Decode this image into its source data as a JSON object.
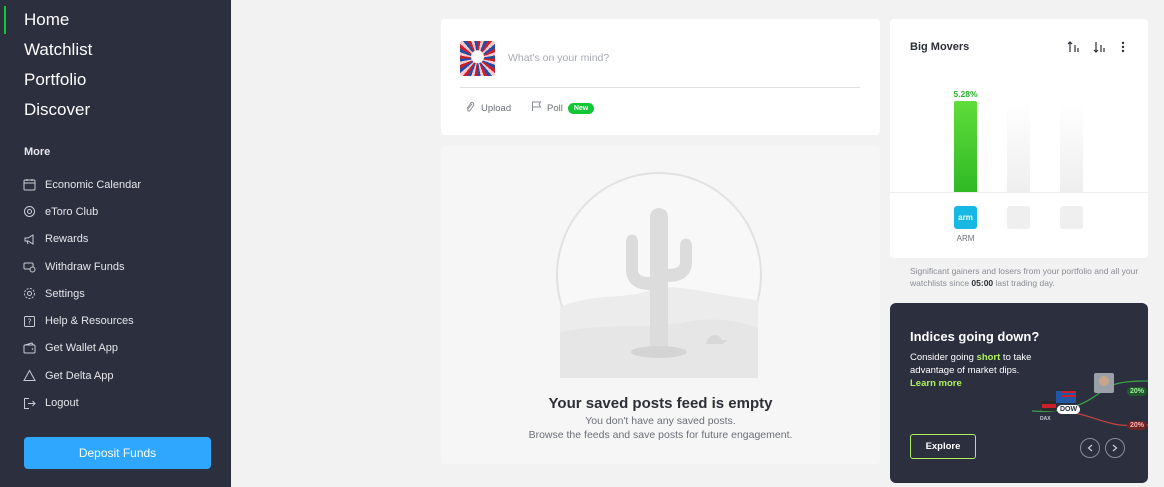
{
  "sidebar": {
    "nav": [
      {
        "label": "Home"
      },
      {
        "label": "Watchlist"
      },
      {
        "label": "Portfolio"
      },
      {
        "label": "Discover"
      }
    ],
    "more_title": "More",
    "more": [
      {
        "label": "Economic Calendar",
        "icon": "calendar-icon"
      },
      {
        "label": "eToro Club",
        "icon": "club-icon"
      },
      {
        "label": "Rewards",
        "icon": "megaphone-icon"
      },
      {
        "label": "Withdraw Funds",
        "icon": "withdraw-icon"
      },
      {
        "label": "Settings",
        "icon": "gear-icon"
      },
      {
        "label": "Help & Resources",
        "icon": "help-icon"
      },
      {
        "label": "Get Wallet App",
        "icon": "wallet-icon"
      },
      {
        "label": "Get Delta App",
        "icon": "delta-icon"
      },
      {
        "label": "Logout",
        "icon": "logout-icon"
      }
    ],
    "deposit_label": "Deposit Funds"
  },
  "composer": {
    "placeholder": "What's on your mind?",
    "upload_label": "Upload",
    "poll_label": "Poll",
    "poll_badge": "New"
  },
  "empty_feed": {
    "title": "Your saved posts feed is empty",
    "subtitle_line1": "You don't have any saved posts.",
    "subtitle_line2": "Browse the feeds and save posts for future engagement."
  },
  "big_movers": {
    "title": "Big Movers",
    "movers": [
      {
        "ticker": "ARM",
        "logo_text": "arm",
        "change": "5.28%",
        "change_value": 5.28
      }
    ],
    "note_before": "Significant gainers and losers from your portfolio and all your watchlists since ",
    "note_time": "05:00",
    "note_after": " last trading day."
  },
  "promo": {
    "title": "Indices going down?",
    "text_before": "Consider going ",
    "text_highlight": "short",
    "text_after": " to take advantage of market dips.",
    "learn_more": "Learn more",
    "explore_label": "Explore",
    "graphic": {
      "index_label": "DOW",
      "small_label": "DAX",
      "gain_label": "20%",
      "loss_label": "20%"
    }
  },
  "colors": {
    "sidebar_bg": "#2b2f3e",
    "accent_green": "#13c636",
    "deposit_blue": "#2fa7ff",
    "promo_accent": "#aef15a"
  }
}
